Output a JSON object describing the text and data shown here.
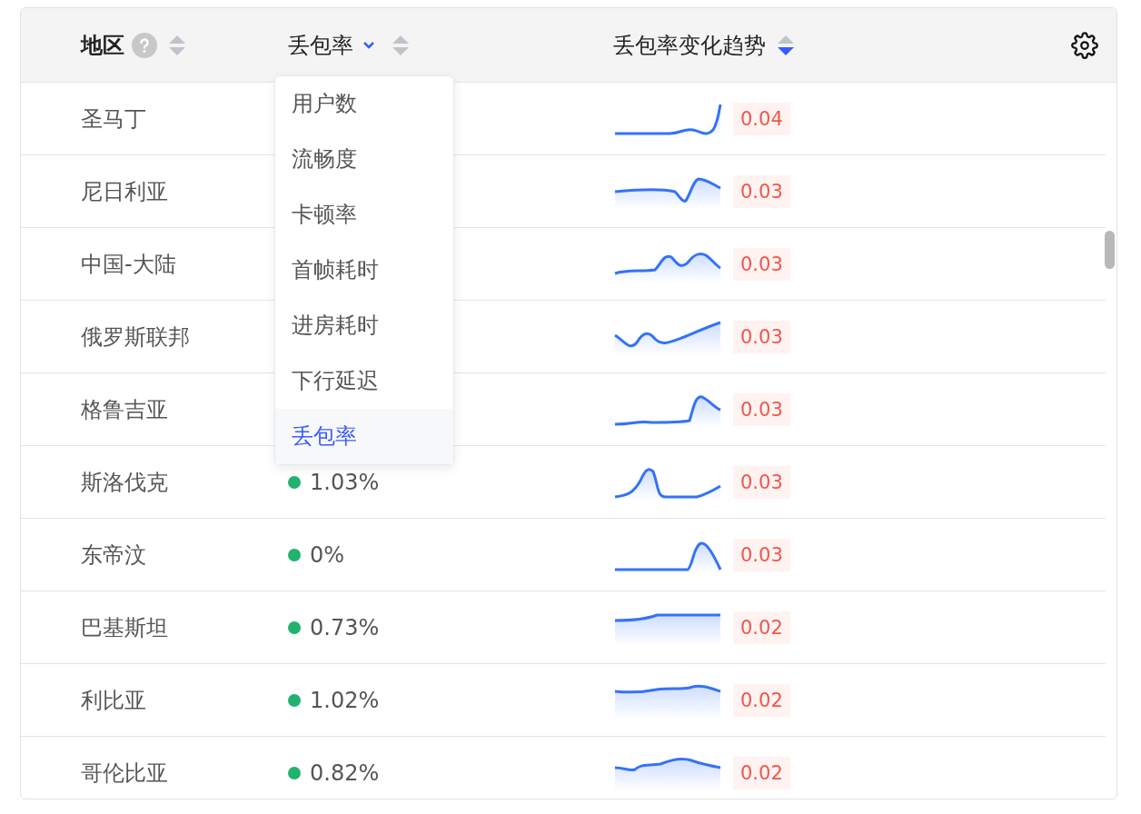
{
  "table": {
    "columns": [
      {
        "label": "地区",
        "help": true,
        "dropdown": false,
        "sorted_desc": false
      },
      {
        "label": "丢包率",
        "help": false,
        "dropdown": true,
        "sorted_desc": false
      },
      {
        "label": "丢包率变化趋势",
        "help": false,
        "dropdown": false,
        "sorted_desc": true
      }
    ],
    "rows": [
      {
        "region": "圣马丁",
        "change": "0.04"
      },
      {
        "region": "尼日利亚",
        "change": "0.03"
      },
      {
        "region": "中国-大陆",
        "change": "0.03"
      },
      {
        "region": "俄罗斯联邦",
        "change": "0.03"
      },
      {
        "region": "格鲁吉亚",
        "change": "0.03"
      },
      {
        "region": "斯洛伐克",
        "value": "1.03%",
        "color": "#21b26f",
        "change": "0.03"
      },
      {
        "region": "东帝汶",
        "value": "0%",
        "color": "#21b26f",
        "change": "0.03"
      },
      {
        "region": "巴基斯坦",
        "value": "0.73%",
        "color": "#21b26f",
        "change": "0.02"
      },
      {
        "region": "利比亚",
        "value": "1.02%",
        "color": "#21b26f",
        "change": "0.02"
      },
      {
        "region": "哥伦比亚",
        "value": "0.82%",
        "color": "#21b26f",
        "change": "0.02"
      }
    ]
  },
  "metric_menu": {
    "expanded": true,
    "items": [
      {
        "label": "用户数",
        "selected": false
      },
      {
        "label": "流畅度",
        "selected": false
      },
      {
        "label": "卡顿率",
        "selected": false
      },
      {
        "label": "首帧耗时",
        "selected": false
      },
      {
        "label": "进房耗时",
        "selected": false
      },
      {
        "label": "下行延迟",
        "selected": false
      },
      {
        "label": "丢包率",
        "selected": true
      }
    ]
  }
}
